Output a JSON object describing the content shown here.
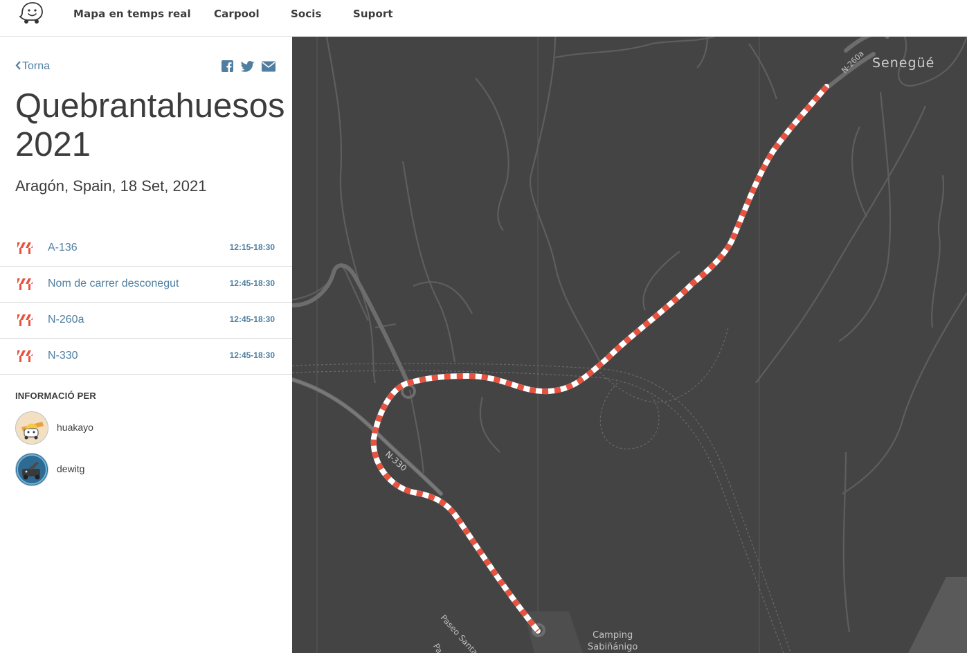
{
  "nav": {
    "logo": "waze-logo",
    "links": [
      "Mapa en temps real",
      "Carpool",
      "Socis",
      "Suport"
    ]
  },
  "sidebar": {
    "back_label": "Torna",
    "share_icons": [
      "facebook-icon",
      "twitter-icon",
      "email-icon"
    ],
    "title_line1": "Quebrantahuesos",
    "title_line2": "2021",
    "subtitle": "Aragón, Spain, 18 Set, 2021",
    "closures": [
      {
        "name": "A-136",
        "time": "12:15-18:30",
        "icon": "road-closed-icon"
      },
      {
        "name": "Nom de carrer desconegut",
        "time": "12:45-18:30",
        "icon": "road-closed-icon"
      },
      {
        "name": "N-260a",
        "time": "12:45-18:30",
        "icon": "road-closed-icon"
      },
      {
        "name": "N-330",
        "time": "12:45-18:30",
        "icon": "road-closed-icon"
      }
    ],
    "info_label": "INFORMACIÓ PER",
    "users": [
      {
        "name": "huakayo"
      },
      {
        "name": "dewitg"
      }
    ]
  },
  "map": {
    "labels": {
      "town": "Senegüé",
      "road_n260a": "N-260a",
      "road_n330": "N-330",
      "street": "Paseo Santa Lucía",
      "street_cut": "Pa",
      "camping_line1": "Camping",
      "camping_line2": "Sabiñánigo"
    },
    "colors": {
      "background": "#444444",
      "closure_red": "#e8523f",
      "closure_white": "#ffffff"
    }
  }
}
